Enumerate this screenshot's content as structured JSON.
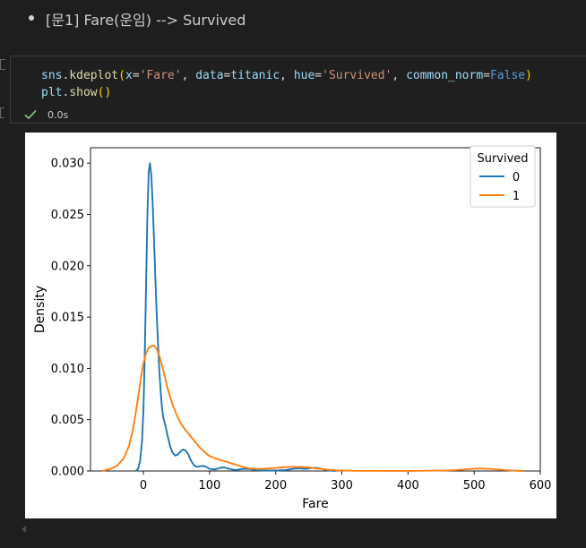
{
  "markdown": {
    "bullet_text": "[문1] Fare(운임) --> Survived"
  },
  "code_cell": {
    "line1": [
      {
        "t": "sns",
        "c": "var"
      },
      {
        "t": ".",
        "c": "pun"
      },
      {
        "t": "kdeplot",
        "c": "fn"
      },
      {
        "t": "(",
        "c": "paren"
      },
      {
        "t": "x",
        "c": "var"
      },
      {
        "t": "=",
        "c": "pun"
      },
      {
        "t": "'Fare'",
        "c": "str"
      },
      {
        "t": ", ",
        "c": "pun"
      },
      {
        "t": "data",
        "c": "var"
      },
      {
        "t": "=",
        "c": "pun"
      },
      {
        "t": "titanic",
        "c": "var"
      },
      {
        "t": ", ",
        "c": "pun"
      },
      {
        "t": "hue",
        "c": "var"
      },
      {
        "t": "=",
        "c": "pun"
      },
      {
        "t": "'Survived'",
        "c": "str"
      },
      {
        "t": ", ",
        "c": "pun"
      },
      {
        "t": "common_norm",
        "c": "var"
      },
      {
        "t": "=",
        "c": "pun"
      },
      {
        "t": "False",
        "c": "kw"
      },
      {
        "t": ")",
        "c": "paren"
      }
    ],
    "line2": [
      {
        "t": "plt",
        "c": "var"
      },
      {
        "t": ".",
        "c": "pun"
      },
      {
        "t": "show",
        "c": "fn"
      },
      {
        "t": "()",
        "c": "paren"
      }
    ],
    "status": {
      "icon": "check-icon",
      "elapsed": "0.0s",
      "color": "#89d185"
    }
  },
  "chart_data": {
    "type": "line",
    "title": "",
    "xlabel": "Fare",
    "ylabel": "Density",
    "xlim": [
      -80,
      600
    ],
    "ylim": [
      0,
      0.0315
    ],
    "x_ticks": [
      0,
      100,
      200,
      300,
      400,
      500,
      600
    ],
    "x_tick_labels": [
      "0",
      "100",
      "200",
      "300",
      "400",
      "500",
      "600"
    ],
    "y_ticks": [
      0,
      0.005,
      0.01,
      0.015,
      0.02,
      0.025,
      0.03
    ],
    "y_tick_labels": [
      "0.000",
      "0.005",
      "0.010",
      "0.015",
      "0.020",
      "0.025",
      "0.030"
    ],
    "grid": false,
    "legend": {
      "title": "Survived",
      "placement": "top-right",
      "entries": [
        "0",
        "1"
      ]
    },
    "series": [
      {
        "name": "0",
        "color": "#1f77b4",
        "points": [
          [
            -12,
            0.0
          ],
          [
            -8,
            0.0002
          ],
          [
            -5,
            0.001
          ],
          [
            -2,
            0.003
          ],
          [
            0,
            0.006
          ],
          [
            2,
            0.011
          ],
          [
            4,
            0.018
          ],
          [
            6,
            0.025
          ],
          [
            8,
            0.0292
          ],
          [
            10,
            0.03
          ],
          [
            12,
            0.0288
          ],
          [
            14,
            0.026
          ],
          [
            16,
            0.0225
          ],
          [
            18,
            0.019
          ],
          [
            20,
            0.0155
          ],
          [
            22,
            0.0125
          ],
          [
            24,
            0.0098
          ],
          [
            26,
            0.0078
          ],
          [
            28,
            0.0062
          ],
          [
            30,
            0.0052
          ],
          [
            33,
            0.0045
          ],
          [
            36,
            0.0036
          ],
          [
            40,
            0.0025
          ],
          [
            44,
            0.0018
          ],
          [
            48,
            0.0015
          ],
          [
            52,
            0.0016
          ],
          [
            56,
            0.0019
          ],
          [
            60,
            0.0021
          ],
          [
            64,
            0.002
          ],
          [
            68,
            0.0016
          ],
          [
            72,
            0.001
          ],
          [
            76,
            0.0006
          ],
          [
            80,
            0.0004
          ],
          [
            85,
            0.00045
          ],
          [
            90,
            0.0005
          ],
          [
            95,
            0.0004
          ],
          [
            100,
            0.0002
          ],
          [
            108,
            0.00015
          ],
          [
            115,
            0.0003
          ],
          [
            122,
            0.00035
          ],
          [
            130,
            0.0002
          ],
          [
            140,
            0.0001
          ],
          [
            150,
            0.0002
          ],
          [
            160,
            0.0002
          ],
          [
            170,
            0.0001
          ],
          [
            180,
            5e-05
          ],
          [
            200,
            5e-05
          ],
          [
            215,
            0.0001
          ],
          [
            225,
            0.0002
          ],
          [
            235,
            0.00025
          ],
          [
            245,
            0.0002
          ],
          [
            255,
            0.0003
          ],
          [
            263,
            0.0003
          ],
          [
            270,
            0.0002
          ],
          [
            280,
            5e-05
          ],
          [
            290,
            0.0
          ]
        ]
      },
      {
        "name": "1",
        "color": "#ff7f0e",
        "points": [
          [
            -62,
            0.0
          ],
          [
            -50,
            0.0002
          ],
          [
            -40,
            0.0005
          ],
          [
            -30,
            0.0012
          ],
          [
            -22,
            0.0024
          ],
          [
            -16,
            0.004
          ],
          [
            -12,
            0.0055
          ],
          [
            -8,
            0.0072
          ],
          [
            -4,
            0.009
          ],
          [
            0,
            0.0105
          ],
          [
            4,
            0.0115
          ],
          [
            8,
            0.012
          ],
          [
            12,
            0.0122
          ],
          [
            16,
            0.0122
          ],
          [
            20,
            0.0119
          ],
          [
            24,
            0.0112
          ],
          [
            28,
            0.0103
          ],
          [
            32,
            0.0093
          ],
          [
            36,
            0.0082
          ],
          [
            40,
            0.0073
          ],
          [
            45,
            0.0063
          ],
          [
            50,
            0.0055
          ],
          [
            55,
            0.0048
          ],
          [
            60,
            0.0043
          ],
          [
            65,
            0.0039
          ],
          [
            70,
            0.0035
          ],
          [
            75,
            0.0031
          ],
          [
            80,
            0.0027
          ],
          [
            85,
            0.0023
          ],
          [
            90,
            0.002
          ],
          [
            95,
            0.0017
          ],
          [
            100,
            0.00145
          ],
          [
            110,
            0.0012
          ],
          [
            120,
            0.001
          ],
          [
            130,
            0.0008
          ],
          [
            140,
            0.0006
          ],
          [
            150,
            0.0004
          ],
          [
            160,
            0.00025
          ],
          [
            170,
            0.0002
          ],
          [
            180,
            0.0002
          ],
          [
            190,
            0.00025
          ],
          [
            200,
            0.0003
          ],
          [
            210,
            0.00035
          ],
          [
            220,
            0.0004
          ],
          [
            230,
            0.0004
          ],
          [
            240,
            0.0004
          ],
          [
            250,
            0.00035
          ],
          [
            260,
            0.00025
          ],
          [
            270,
            0.0002
          ],
          [
            280,
            0.00012
          ],
          [
            295,
            5e-05
          ],
          [
            320,
            2e-05
          ],
          [
            400,
            1e-05
          ],
          [
            460,
            5e-05
          ],
          [
            480,
            0.00012
          ],
          [
            495,
            0.0002
          ],
          [
            510,
            0.00025
          ],
          [
            525,
            0.0002
          ],
          [
            540,
            0.00012
          ],
          [
            555,
            5e-05
          ],
          [
            575,
            0.0
          ]
        ]
      }
    ]
  }
}
